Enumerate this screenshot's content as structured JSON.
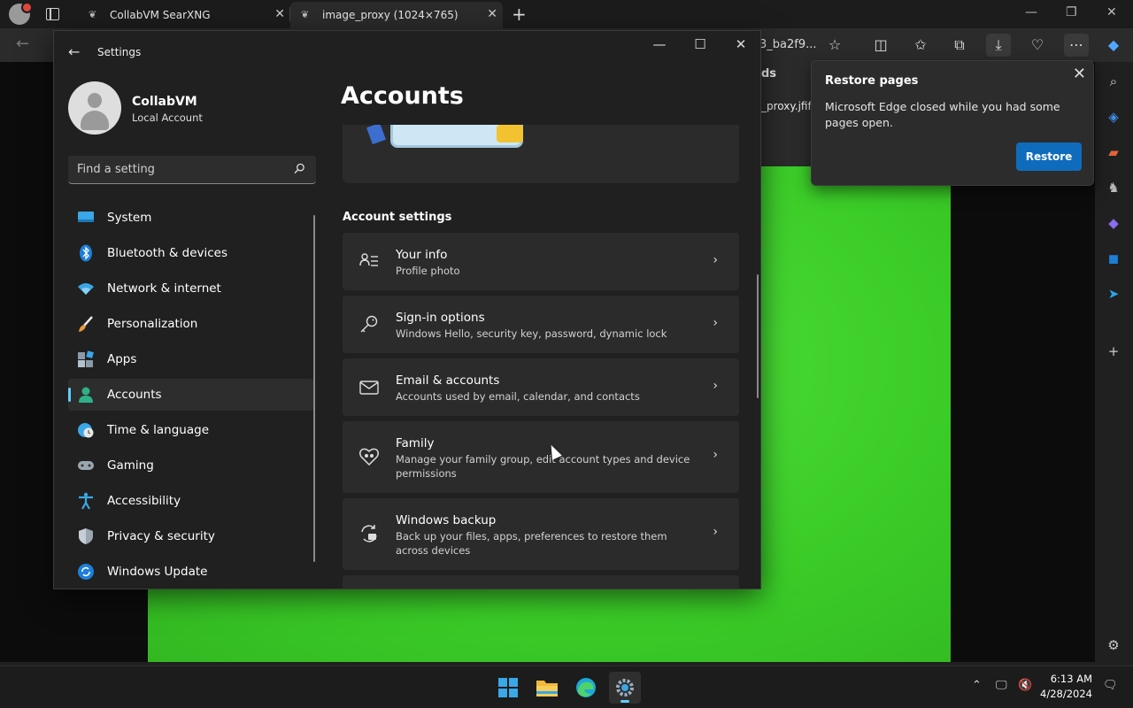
{
  "browser": {
    "tabs": [
      {
        "title": "CollabVM SearXNG"
      },
      {
        "title": "image_proxy (1024×765)"
      }
    ],
    "url_fragment": "3_ba2f9...",
    "downloads_heading": "ds",
    "downloads_file": "_proxy.jfif"
  },
  "restore_popup": {
    "title": "Restore pages",
    "message": "Microsoft Edge closed while you had some pages open.",
    "button": "Restore"
  },
  "settings": {
    "app_title": "Settings",
    "user": {
      "name": "CollabVM",
      "type": "Local Account"
    },
    "search_placeholder": "Find a setting",
    "page_title": "Accounts",
    "section_label": "Account settings",
    "nav": [
      {
        "label": "System",
        "icon": "system-icon"
      },
      {
        "label": "Bluetooth & devices",
        "icon": "bluetooth-icon"
      },
      {
        "label": "Network & internet",
        "icon": "wifi-icon"
      },
      {
        "label": "Personalization",
        "icon": "brush-icon"
      },
      {
        "label": "Apps",
        "icon": "apps-icon"
      },
      {
        "label": "Accounts",
        "icon": "accounts-icon",
        "active": true
      },
      {
        "label": "Time & language",
        "icon": "globe-clock-icon"
      },
      {
        "label": "Gaming",
        "icon": "gamepad-icon"
      },
      {
        "label": "Accessibility",
        "icon": "accessibility-icon"
      },
      {
        "label": "Privacy & security",
        "icon": "shield-icon"
      },
      {
        "label": "Windows Update",
        "icon": "update-icon"
      }
    ],
    "cards": [
      {
        "title": "Your info",
        "subtitle": "Profile photo",
        "icon": "person-info-icon"
      },
      {
        "title": "Sign-in options",
        "subtitle": "Windows Hello, security key, password, dynamic lock",
        "icon": "key-icon"
      },
      {
        "title": "Email & accounts",
        "subtitle": "Accounts used by email, calendar, and contacts",
        "icon": "mail-icon"
      },
      {
        "title": "Family",
        "subtitle": "Manage your family group, edit account types and device permissions",
        "icon": "family-heart-icon"
      },
      {
        "title": "Windows backup",
        "subtitle": "Back up your files, apps, preferences to restore them across devices",
        "icon": "backup-icon"
      }
    ]
  },
  "taskbar": {
    "time": "6:13 AM",
    "date": "4/28/2024"
  },
  "colors": {
    "accent": "#60cdff",
    "button_blue": "#0f6cbd",
    "page_green": "#3fd12d"
  }
}
